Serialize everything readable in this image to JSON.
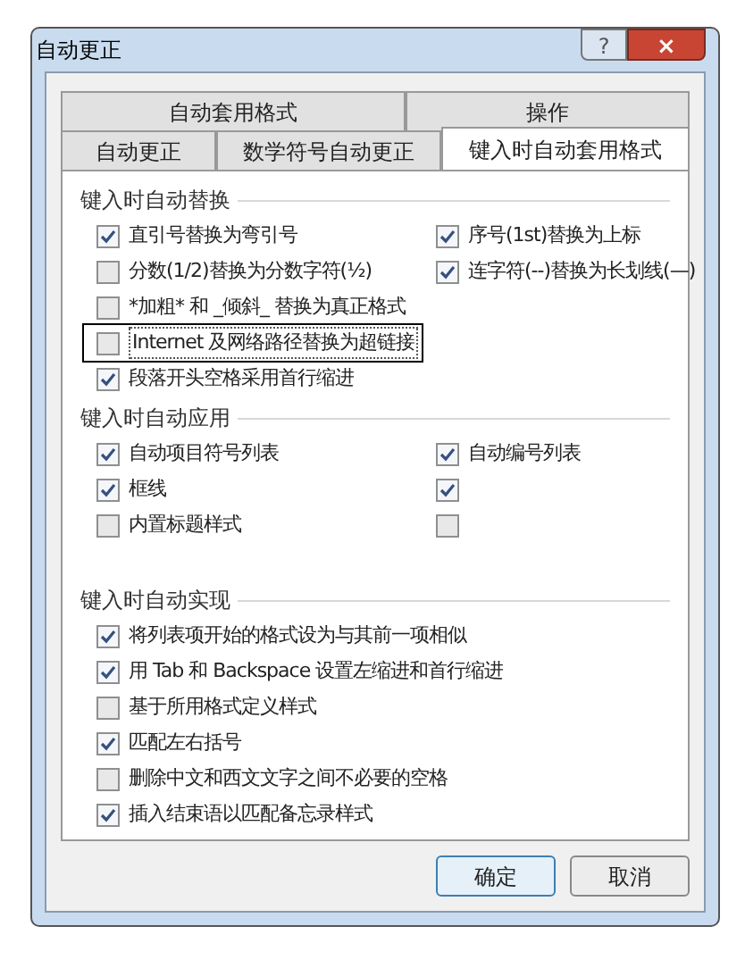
{
  "window": {
    "title": "自动更正",
    "help_button": "?",
    "close_button": "×"
  },
  "tab_rows": [
    [
      {
        "label": "自动套用格式",
        "selected": false
      },
      {
        "label": "操作",
        "selected": false
      }
    ],
    [
      {
        "label": "自动更正",
        "selected": false
      },
      {
        "label": "数学符号自动更正",
        "selected": false
      },
      {
        "label": "键入时自动套用格式",
        "selected": true
      }
    ]
  ],
  "sections": [
    {
      "title": "键入时自动替换",
      "rows": [
        [
          {
            "label": "直引号替换为弯引号",
            "checked": true
          },
          {
            "label": "序号(1st)替换为上标",
            "checked": true
          }
        ],
        [
          {
            "label": "分数(1/2)替换为分数字符(½)",
            "checked": false
          },
          {
            "label": "连字符(--)替换为长划线(—)",
            "checked": true
          }
        ],
        [
          {
            "label": "*加粗* 和 _倾斜_ 替换为真正格式",
            "checked": false
          }
        ],
        [
          {
            "label": "Internet 及网络路径替换为超链接",
            "checked": false,
            "focused": true
          }
        ],
        [
          {
            "label": "段落开头空格采用首行缩进",
            "checked": true
          }
        ]
      ]
    },
    {
      "title": "键入时自动应用",
      "rows": [
        [
          {
            "label": "自动项目符号列表",
            "checked": true
          },
          {
            "label": "自动编号列表",
            "checked": true
          }
        ],
        [
          {
            "label": "框线",
            "checked": true
          },
          {
            "checked": true
          }
        ],
        [
          {
            "label": "内置标题样式",
            "checked": false
          },
          {
            "checked": false
          }
        ]
      ]
    },
    {
      "title": "键入时自动实现",
      "rows": [
        [
          {
            "label": "将列表项开始的格式设为与其前一项相似",
            "checked": true
          }
        ],
        [
          {
            "label": "用 Tab 和 Backspace 设置左缩进和首行缩进",
            "checked": true
          }
        ],
        [
          {
            "label": "基于所用格式定义样式",
            "checked": false
          }
        ],
        [
          {
            "label": "匹配左右括号",
            "checked": true
          }
        ],
        [
          {
            "label": "删除中文和西文文字之间不必要的空格",
            "checked": false
          }
        ],
        [
          {
            "label": "插入结束语以匹配备忘录样式",
            "checked": true
          }
        ]
      ]
    }
  ],
  "buttons": [
    {
      "label": "确定",
      "default": true
    },
    {
      "label": "取消",
      "default": false
    }
  ]
}
